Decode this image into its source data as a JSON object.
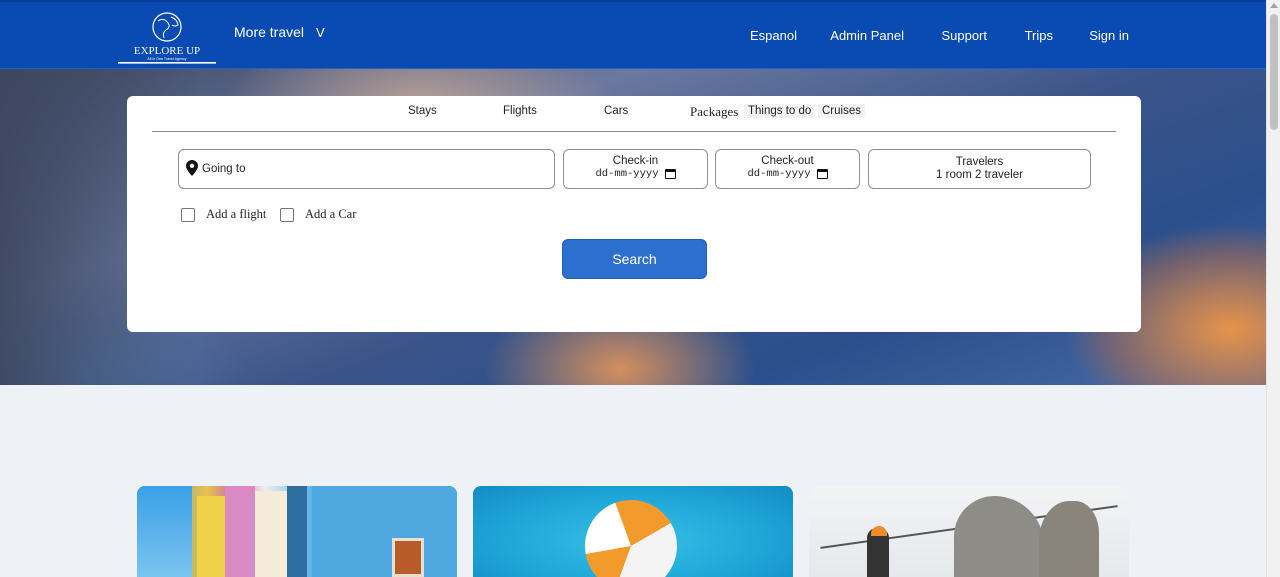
{
  "header": {
    "logo": {
      "title": "EXPLORE UP",
      "tagline": "All in One Travel Agency",
      "icon": "globe-icon"
    },
    "more_travel": "More travel",
    "more_travel_chevron": "V",
    "nav": [
      "Espanol",
      "Admin Panel",
      "Support",
      "Trips",
      "Sign in"
    ]
  },
  "search": {
    "tabs": [
      "Stays",
      "Flights",
      "Cars",
      "Packages",
      "Things to do",
      "Cruises"
    ],
    "going_to_placeholder": "Going to",
    "checkin": {
      "label": "Check-in",
      "value": "dd-mm-yyyy"
    },
    "checkout": {
      "label": "Check-out",
      "value": "dd-mm-yyyy"
    },
    "travelers": {
      "label": "Travelers",
      "value": "1 room 2 traveler"
    },
    "add_flight": "Add a flight",
    "add_car": "Add a Car",
    "button": "Search"
  },
  "colors": {
    "brand": "#0a4bb3",
    "button": "#2c6fce",
    "page_bg": "#eef1f5"
  }
}
